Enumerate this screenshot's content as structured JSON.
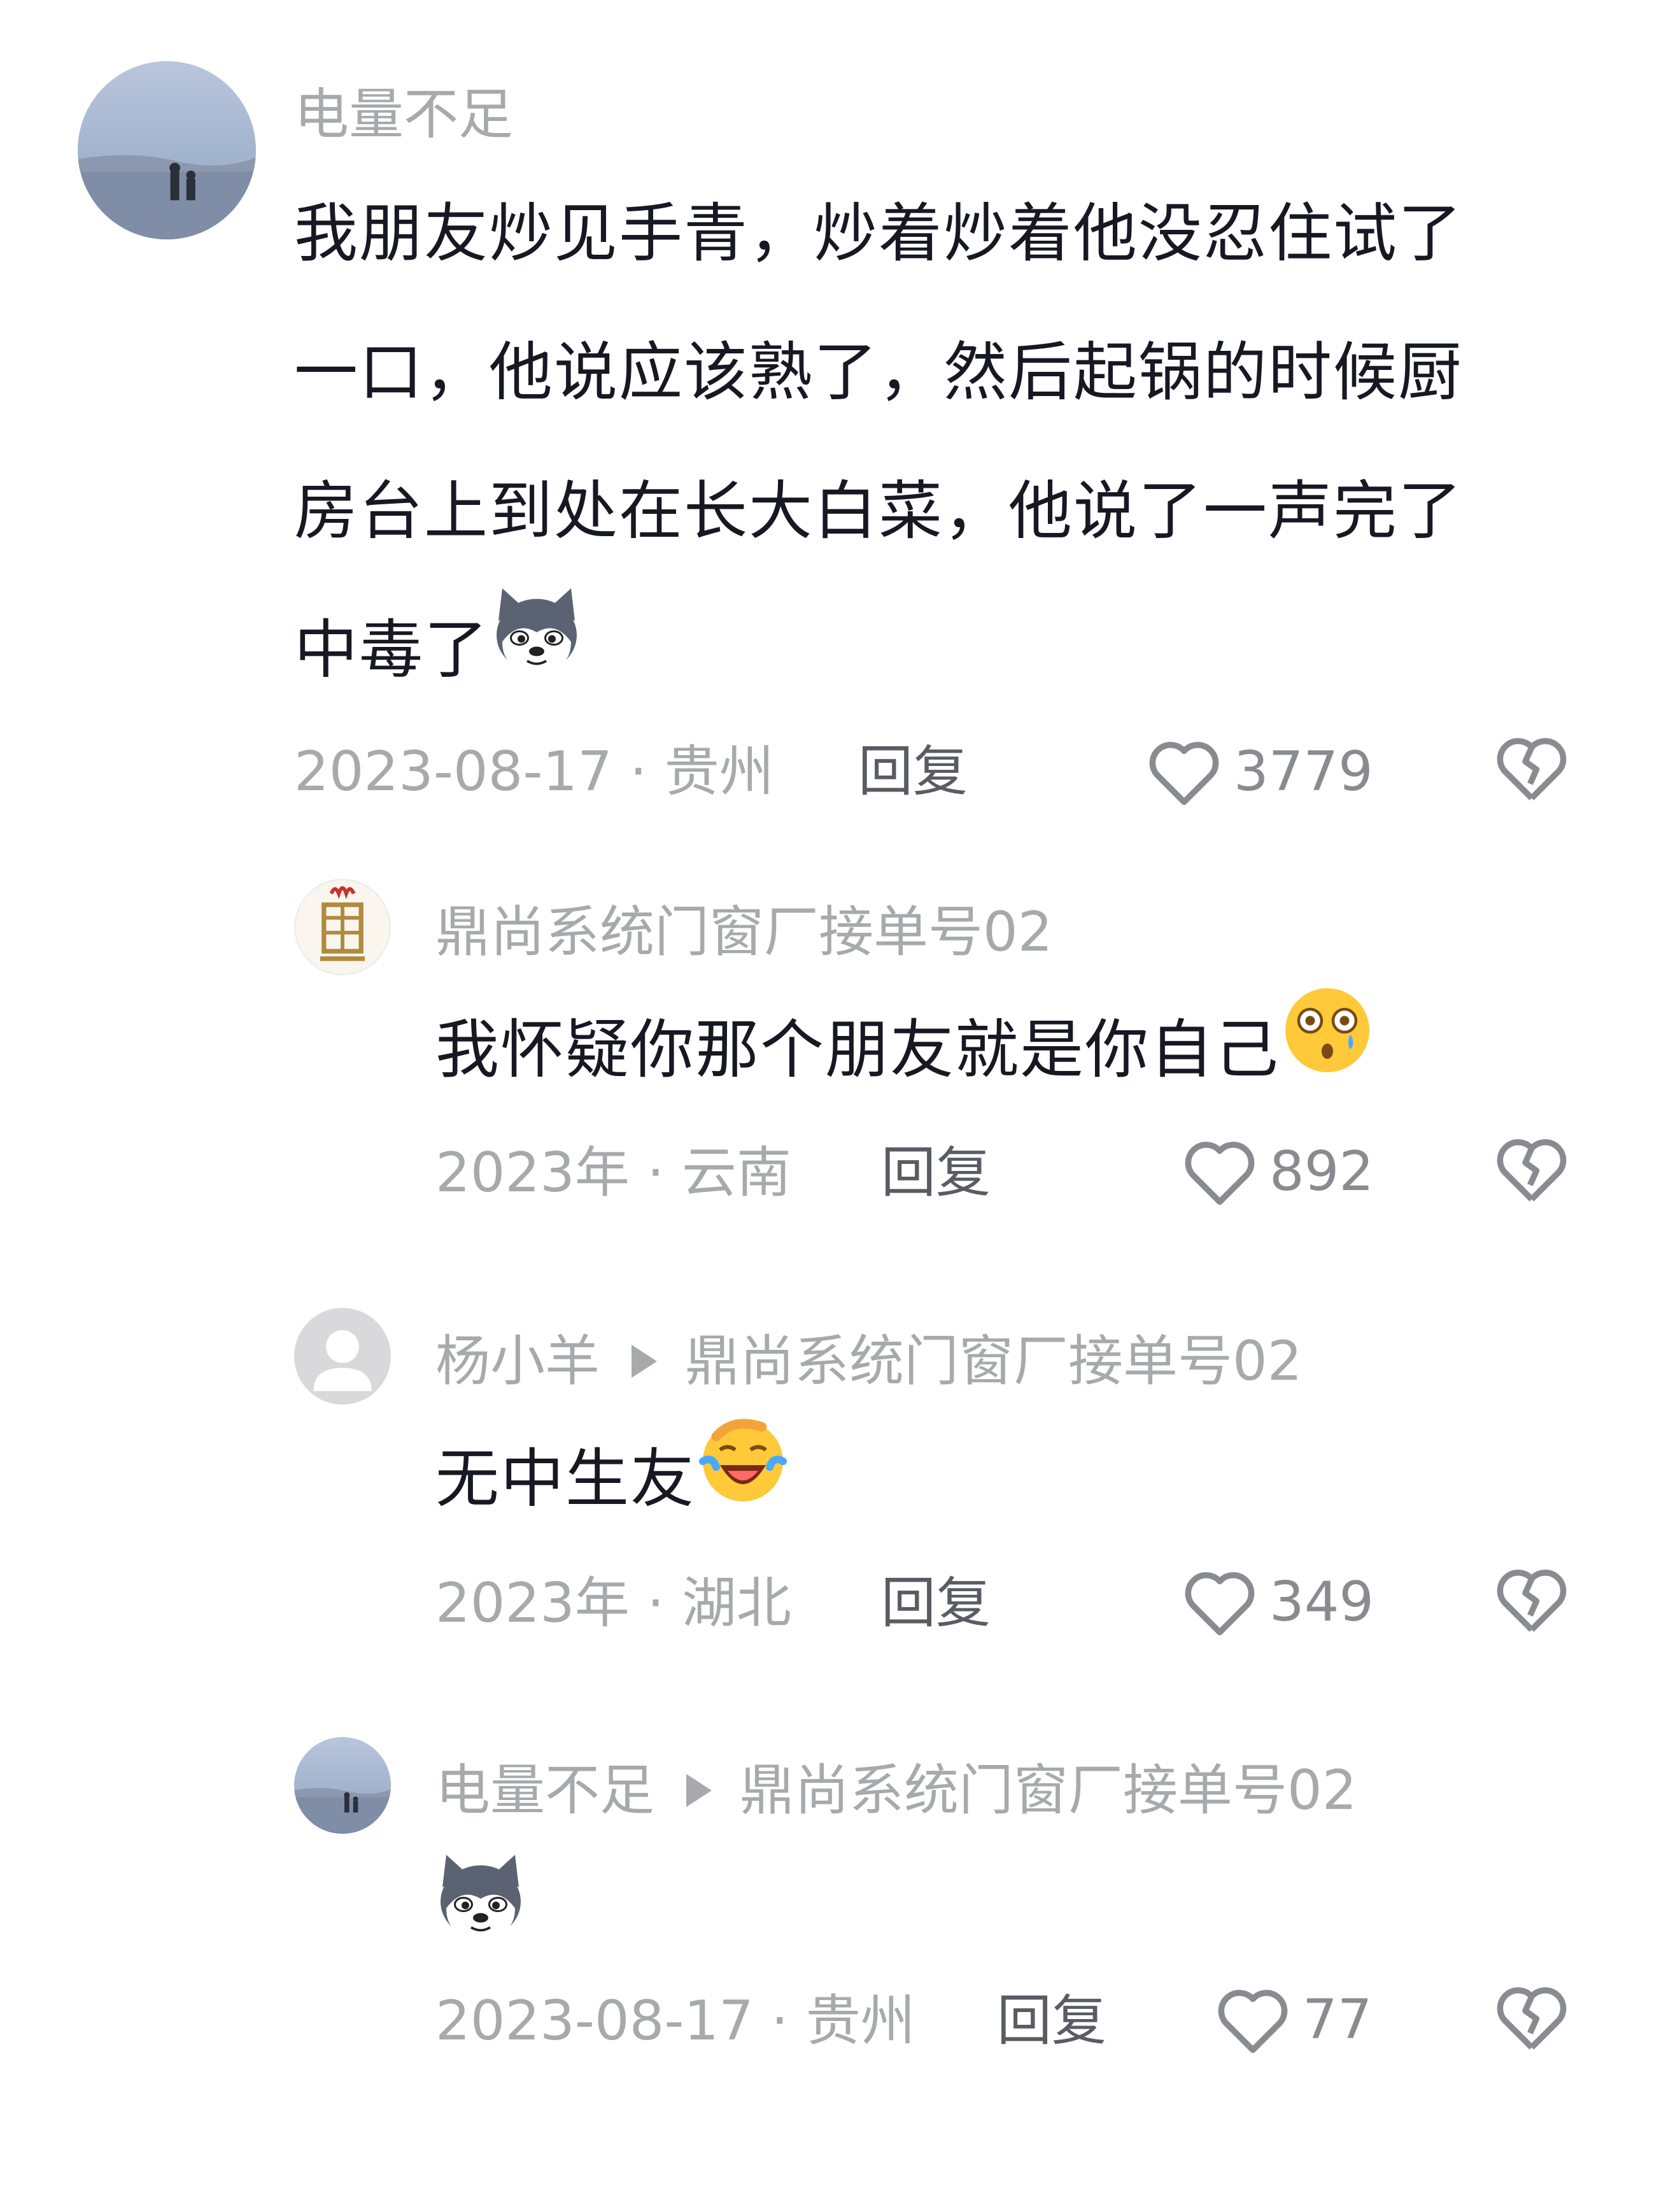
{
  "comments": [
    {
      "username": "电量不足",
      "lines": [
        "我朋友炒见手青，炒着炒着他没忍住试了",
        "一口，他说应该熟了，然后起锅的时候厨",
        "房台上到处在长大白菜，他说了一声完了",
        "中毒了"
      ],
      "emoji": "husky-emoji",
      "meta": "2023-08-17 · 贵州",
      "reply_label": "回复",
      "likes": "3779"
    },
    {
      "username": "鼎尚系统门窗厂接单号02",
      "lines": [
        "我怀疑你那个朋友就是你自己"
      ],
      "emoji": "shocked-tear-emoji",
      "meta": "2023年 · 云南",
      "reply_label": "回复",
      "likes": "892"
    },
    {
      "username": "杨小羊",
      "reply_to": "鼎尚系统门窗厂接单号02",
      "lines": [
        "无中生友"
      ],
      "emoji": "laugh-cry-emoji",
      "meta": "2023年 · 湖北",
      "reply_label": "回复",
      "likes": "349"
    },
    {
      "username": "电量不足",
      "reply_to": "鼎尚系统门窗厂接单号02",
      "lines": [],
      "emoji": "husky-emoji",
      "meta": "2023-08-17 · 贵州",
      "reply_label": "回复",
      "likes": "77"
    }
  ],
  "colors": {
    "text_primary": "#161823",
    "text_secondary": "#a8a9ad",
    "reply": "#5a5b63",
    "icon": "#8a8b91"
  },
  "icons": {
    "like": "heart-outline-icon",
    "dislike": "broken-heart-icon",
    "reply_arrow": "play-arrow-icon"
  }
}
